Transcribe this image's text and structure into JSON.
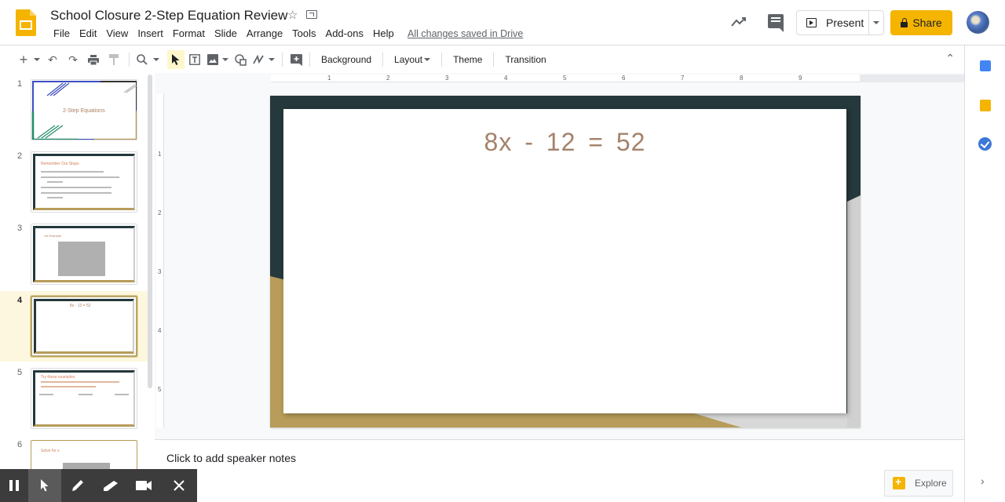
{
  "app": {
    "title": "School Closure 2-Step Equation Review",
    "saved_status": "All changes saved in Drive",
    "menu": [
      "File",
      "Edit",
      "View",
      "Insert",
      "Format",
      "Slide",
      "Arrange",
      "Tools",
      "Add-ons",
      "Help"
    ],
    "present_label": "Present",
    "share_label": "Share"
  },
  "toolbar": {
    "background_label": "Background",
    "layout_label": "Layout",
    "theme_label": "Theme",
    "transition_label": "Transition"
  },
  "ruler": {
    "horizontal": [
      "1",
      "2",
      "3",
      "4",
      "5",
      "6",
      "7",
      "8",
      "9"
    ],
    "vertical": [
      "1",
      "2",
      "3",
      "4",
      "5"
    ]
  },
  "filmstrip": {
    "active_slide": 4,
    "slides": [
      {
        "number": "1",
        "text": "2-Step Equations"
      },
      {
        "number": "2",
        "text": "Remember Our Steps"
      },
      {
        "number": "3",
        "text": "1st Example"
      },
      {
        "number": "4",
        "text": "8x - 12 = 52"
      },
      {
        "number": "5",
        "text": "Try these examples"
      },
      {
        "number": "6",
        "text": "Solve for x"
      }
    ]
  },
  "slide": {
    "equation": "8x - 12 = 52"
  },
  "notes": {
    "placeholder": "Click to add speaker notes"
  },
  "explore": {
    "label": "Explore"
  },
  "colors": {
    "share": "#f4b400",
    "slide_dark": "#25383c",
    "slide_gold": "#b79c5a",
    "equation_text": "#a4826a"
  }
}
